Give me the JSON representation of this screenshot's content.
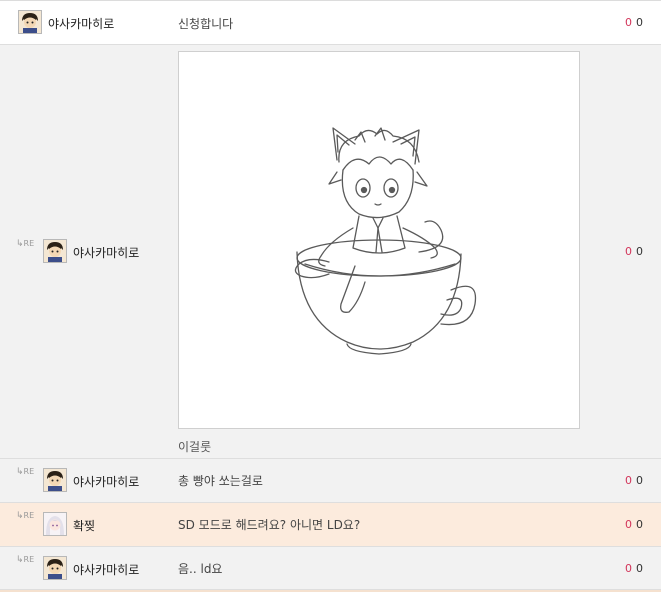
{
  "comments": [
    {
      "nickname": "야사카마히로",
      "text": "신청합니다",
      "votes_up": "0",
      "votes_down": "0"
    },
    {
      "re_label": "RE",
      "nickname": "야사카마히로",
      "image_caption": "이걸룻",
      "votes_up": "0",
      "votes_down": "0"
    },
    {
      "re_label": "RE",
      "nickname": "야사카마히로",
      "text": "총 빵야 쏘는걸로",
      "votes_up": "0",
      "votes_down": "0"
    },
    {
      "re_label": "RE",
      "nickname": "확찢",
      "text": "SD 모드로 해드려요? 아니면 LD요?",
      "votes_up": "0",
      "votes_down": "0"
    },
    {
      "re_label": "RE",
      "nickname": "야사카마히로",
      "text": "음.. ld요",
      "votes_up": "0",
      "votes_down": "0"
    }
  ],
  "colors": {
    "vote_up": "#d2355a",
    "reply_row_bg": "#f2f2f2",
    "highlight_row_bg": "#fcebdd"
  },
  "icons": {
    "reply_arrow": "reply-arrow-icon",
    "avatar_boy": "avatar-dark-hair-boy",
    "avatar_girl": "avatar-white-hair-girl"
  }
}
